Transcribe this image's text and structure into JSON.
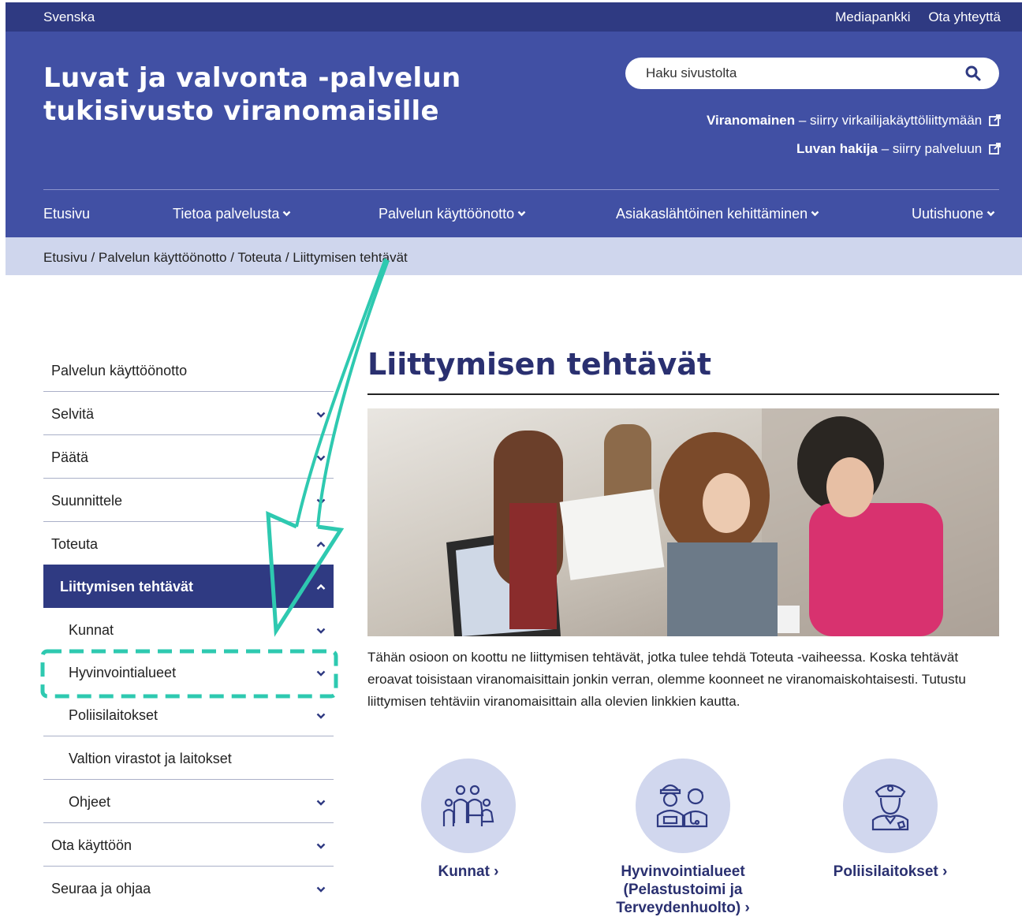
{
  "topbar": {
    "language": "Svenska",
    "links": [
      "Mediapankki",
      "Ota yhteyttä"
    ]
  },
  "header": {
    "title_line1": "Luvat ja valvonta -palvelun",
    "title_line2_a": "tukisivusto",
    "title_line2_b": "viranomaisille",
    "search_placeholder": "Haku sivustolta",
    "link1_bold": "Viranomainen",
    "link1_rest": " – siirry virkailijakäyttöliittymään",
    "link2_bold": "Luvan hakija",
    "link2_rest": " – siirry palveluun"
  },
  "nav": [
    "Etusivu",
    "Tietoa palvelusta",
    "Palvelun käyttöönotto",
    "Asiakaslähtöinen kehittäminen",
    "Uutishuone"
  ],
  "breadcrumb": "Etusivu / Palvelun käyttöönotto / Toteuta / Liittymisen tehtävät",
  "sidebar": {
    "items": [
      {
        "label": "Palvelun käyttöönotto"
      },
      {
        "label": "Selvitä"
      },
      {
        "label": "Päätä"
      },
      {
        "label": "Suunnittele"
      },
      {
        "label": "Toteuta"
      },
      {
        "label": "Liittymisen tehtävät"
      },
      {
        "label": "Kunnat"
      },
      {
        "label": "Hyvinvointialueet"
      },
      {
        "label": "Poliisilaitokset"
      },
      {
        "label": "Valtion virastot ja laitokset"
      },
      {
        "label": "Ohjeet"
      },
      {
        "label": "Ota käyttöön"
      },
      {
        "label": "Seuraa ja ohjaa"
      }
    ]
  },
  "main": {
    "title": "Liittymisen tehtävät",
    "intro": "Tähän osioon on koottu ne liittymisen tehtävät, jotka tulee tehdä Toteuta -vaiheessa. Koska tehtävät eroavat toisistaan viranomaisittain jonkin verran, olemme koonneet ne viranomaiskohtaisesti. Tutustu liittymisen tehtäviin viranomaisittain alla olevien linkkien kautta.",
    "cards": [
      {
        "label": "Kunnat ›",
        "icon": "family-icon"
      },
      {
        "label": "Hyvinvointialueet (Pelastustoimi ja Terveydenhuolto) ›",
        "icon": "firefighter-doctor-icon"
      },
      {
        "label": "Poliisilaitokset ›",
        "icon": "police-officer-icon"
      }
    ]
  },
  "colors": {
    "brand_dark": "#2f3a82",
    "brand": "#4150a4",
    "breadcrumb_bg": "#cfd6ed",
    "annotation": "#2ec9b0"
  }
}
